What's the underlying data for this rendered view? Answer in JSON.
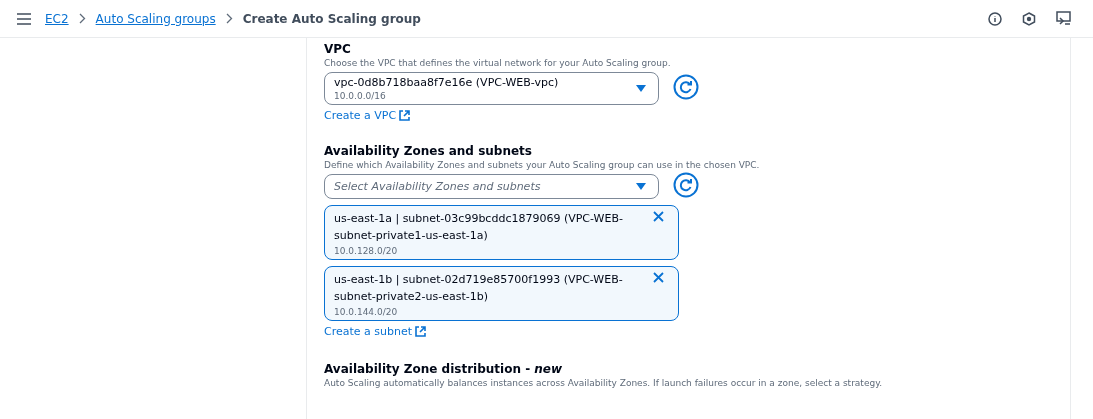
{
  "breadcrumbs": [
    {
      "label": "EC2",
      "link": true
    },
    {
      "label": "Auto Scaling groups",
      "link": true
    },
    {
      "label": "Create Auto Scaling group",
      "link": false
    }
  ],
  "vpc": {
    "label": "VPC",
    "description": "Choose the VPC that defines the virtual network for your Auto Scaling group.",
    "value": "vpc-0d8b718baa8f7e16e (VPC-WEB-vpc)",
    "detail": "10.0.0.0/16",
    "link": "Create a VPC"
  },
  "subnets": {
    "label": "Availability Zones and subnets",
    "description": "Define which Availability Zones and subnets your Auto Scaling group can use in the chosen VPC.",
    "placeholder": "Select Availability Zones and subnets",
    "selected_items": [
      {
        "name": "us-east-1a | subnet-03c99bcddc1879069 (VPC-WEB-subnet-private1-us-east-1a)",
        "cidr": "10.0.128.0/20"
      },
      {
        "name": "us-east-1b | subnet-02d719e85700f1993 (VPC-WEB-subnet-private2-us-east-1b)",
        "cidr": "10.0.144.0/20"
      }
    ],
    "link": "Create a subnet"
  },
  "distribution": {
    "label": "Availability Zone distribution - *new*",
    "description": "Auto Scaling automatically balances instances across Availability Zones. If launch failures occur in a zone, select a strategy."
  }
}
